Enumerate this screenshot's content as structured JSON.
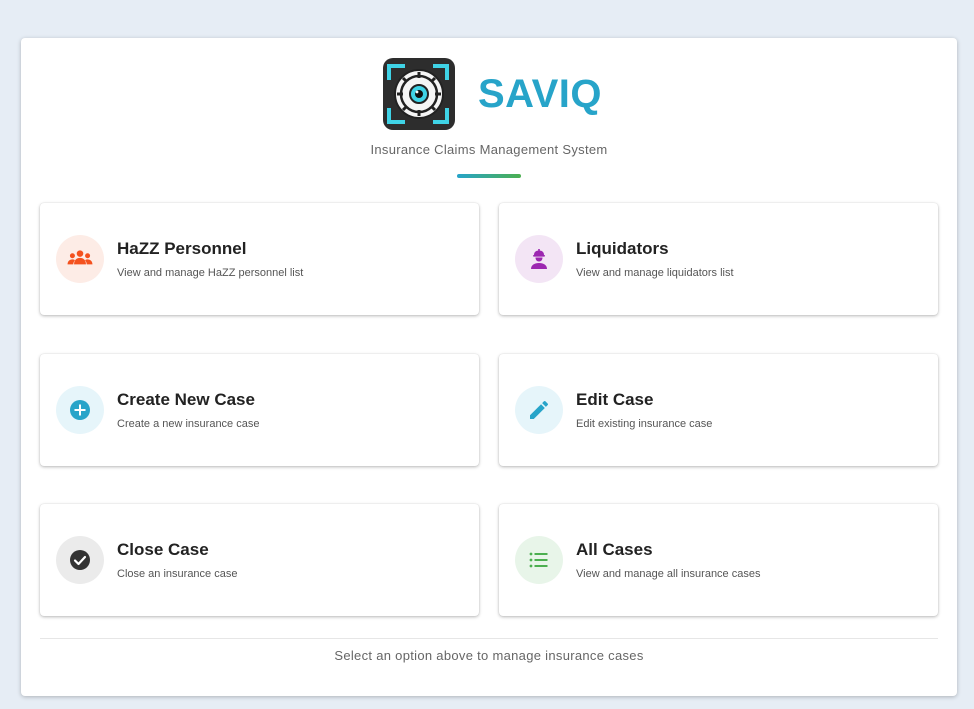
{
  "app": {
    "name": "SAVIQ",
    "subtitle": "Insurance Claims Management System"
  },
  "colors": {
    "brand": "#27a4c9",
    "accent_end": "#4caf50",
    "background": "#e6edf5"
  },
  "cards": [
    {
      "title": "HaZZ Personnel",
      "description": "View and manage HaZZ personnel list",
      "icon": "people-group-icon",
      "color": "#f4511e",
      "tint": "#fdece6"
    },
    {
      "title": "Liquidators",
      "description": "View and manage liquidators list",
      "icon": "engineer-icon",
      "color": "#9c27b0",
      "tint": "#f3e5f5"
    },
    {
      "title": "Create New Case",
      "description": "Create a new insurance case",
      "icon": "add-circle-icon",
      "color": "#27a4c9",
      "tint": "#e6f5fa"
    },
    {
      "title": "Edit Case",
      "description": "Edit existing insurance case",
      "icon": "pencil-icon",
      "color": "#27a4c9",
      "tint": "#e6f5fa"
    },
    {
      "title": "Close Case",
      "description": "Close an insurance case",
      "icon": "check-circle-icon",
      "color": "#333333",
      "tint": "#ebebeb"
    },
    {
      "title": "All Cases",
      "description": "View and manage all insurance cases",
      "icon": "list-icon",
      "color": "#4caf50",
      "tint": "#e8f5e9"
    }
  ],
  "footer": {
    "text": "Select an option above to manage insurance cases"
  }
}
